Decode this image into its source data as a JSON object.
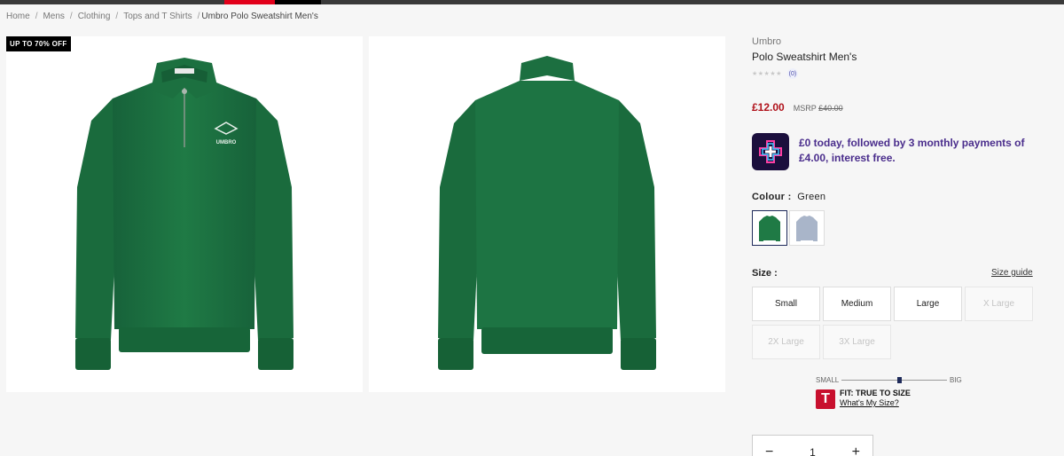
{
  "breadcrumb": {
    "items": [
      "Home",
      "Mens",
      "Clothing",
      "Tops and T Shirts"
    ],
    "current": "Umbro Polo Sweatshirt Men's",
    "separator": "/"
  },
  "gallery": {
    "badge": "UP TO 70% OFF",
    "logo_text": "UMBRO"
  },
  "product": {
    "brand": "Umbro",
    "title": "Polo Sweatshirt Men's",
    "stars": "★★★★★",
    "review_count": "0",
    "price": "£12.00",
    "msrp_label": "MSRP",
    "msrp_value": "£40.00"
  },
  "bnpl": {
    "text": "£0 today, followed by 3 monthly payments of £4.00, interest free."
  },
  "colour": {
    "label": "Colour :",
    "selected": "Green",
    "swatches": [
      "Green",
      "Grey"
    ]
  },
  "size": {
    "label": "Size :",
    "guide": "Size guide",
    "options": [
      {
        "label": "Small",
        "available": true
      },
      {
        "label": "Medium",
        "available": true
      },
      {
        "label": "Large",
        "available": true
      },
      {
        "label": "X Large",
        "available": false
      },
      {
        "label": "2X Large",
        "available": false
      },
      {
        "label": "3X Large",
        "available": false
      }
    ]
  },
  "fit": {
    "small_label": "SMALL",
    "big_label": "BIG",
    "badge": "T",
    "title": "FIT: TRUE TO SIZE",
    "link": "What's My Size?",
    "level": 0.55
  },
  "quantity": {
    "minus": "−",
    "value": "1",
    "plus": "+"
  },
  "colors": {
    "price_red": "#b0121b",
    "bnpl_purple": "#4a2d8c",
    "garment_green": "#1f7a45",
    "fit_red": "#c8102e"
  }
}
